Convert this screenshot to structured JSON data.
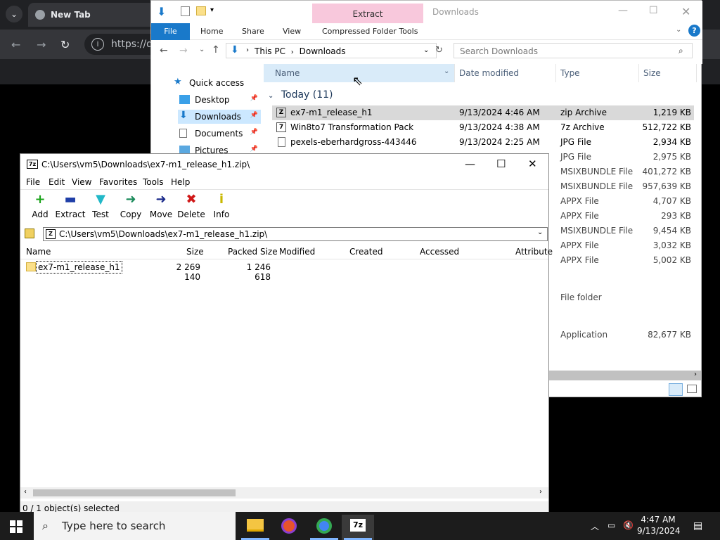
{
  "chrome": {
    "tab_title": "New Tab",
    "url": "https://dr"
  },
  "explorer": {
    "context_tab": "Extract",
    "window_title": "Downloads",
    "ribbon_tabs": [
      "File",
      "Home",
      "Share",
      "View",
      "Compressed Folder Tools"
    ],
    "breadcrumb": [
      "This PC",
      "Downloads"
    ],
    "search_placeholder": "Search Downloads",
    "nav": [
      {
        "label": "Quick access"
      },
      {
        "label": "Desktop"
      },
      {
        "label": "Downloads"
      },
      {
        "label": "Documents"
      },
      {
        "label": "Pictures"
      }
    ],
    "columns": [
      "Name",
      "Date modified",
      "Type",
      "Size"
    ],
    "group_label": "Today (11)",
    "files": [
      {
        "name": "ex7-m1_release_h1",
        "date": "9/13/2024 4:46 AM",
        "type": "zip Archive",
        "size": "1,219 KB"
      },
      {
        "name": "Win8to7 Transformation Pack",
        "date": "9/13/2024 4:38 AM",
        "type": "7z Archive",
        "size": "512,722 KB"
      },
      {
        "name": "pexels-eberhardgross-443446",
        "date": "9/13/2024 2:25 AM",
        "type": "JPG File",
        "size": "2,934 KB"
      }
    ],
    "hidden_rows": [
      {
        "type": "JPG File",
        "size": "2,975 KB"
      },
      {
        "type": "MSIXBUNDLE File",
        "size": "401,272 KB"
      },
      {
        "type": "MSIXBUNDLE File",
        "size": "957,639 KB"
      },
      {
        "type": "APPX File",
        "size": "4,707 KB"
      },
      {
        "type": "APPX File",
        "size": "293 KB"
      },
      {
        "type": "MSIXBUNDLE File",
        "size": "9,454 KB"
      },
      {
        "type": "APPX File",
        "size": "3,032 KB"
      },
      {
        "type": "APPX File",
        "size": "5,002 KB"
      }
    ],
    "folder_type": "File folder",
    "app_type": "Application",
    "app_size": "82,677 KB"
  },
  "zip": {
    "title": "C:\\Users\\vm5\\Downloads\\ex7-m1_release_h1.zip\\",
    "menu": [
      "File",
      "Edit",
      "View",
      "Favorites",
      "Tools",
      "Help"
    ],
    "tools": [
      {
        "label": "Add",
        "icon": "plus-icon",
        "glyph": "+",
        "color": "#1aa31a"
      },
      {
        "label": "Extract",
        "icon": "minus-icon",
        "glyph": "▬",
        "color": "#1f3fa8"
      },
      {
        "label": "Test",
        "icon": "checkmark-icon",
        "glyph": "▼",
        "color": "#22b8c8"
      },
      {
        "label": "Copy",
        "icon": "copy-arrow-icon",
        "glyph": "➜",
        "color": "#1a8a5a"
      },
      {
        "label": "Move",
        "icon": "move-arrow-icon",
        "glyph": "➜",
        "color": "#1a2a8a"
      },
      {
        "label": "Delete",
        "icon": "delete-x-icon",
        "glyph": "✖",
        "color": "#d01818"
      },
      {
        "label": "Info",
        "icon": "info-icon",
        "glyph": "i",
        "color": "#c8b800"
      }
    ],
    "path": "C:\\Users\\vm5\\Downloads\\ex7-m1_release_h1.zip\\",
    "columns": [
      "Name",
      "Size",
      "Packed Size",
      "Modified",
      "Created",
      "Accessed",
      "Attribute"
    ],
    "row": {
      "name": "ex7-m1_release_h1",
      "size": "2 269 140",
      "packed": "1 246 618"
    },
    "status": "0 / 1 object(s) selected"
  },
  "taskbar": {
    "search_placeholder": "Type here to search",
    "time": "4:47 AM",
    "date": "9/13/2024"
  }
}
